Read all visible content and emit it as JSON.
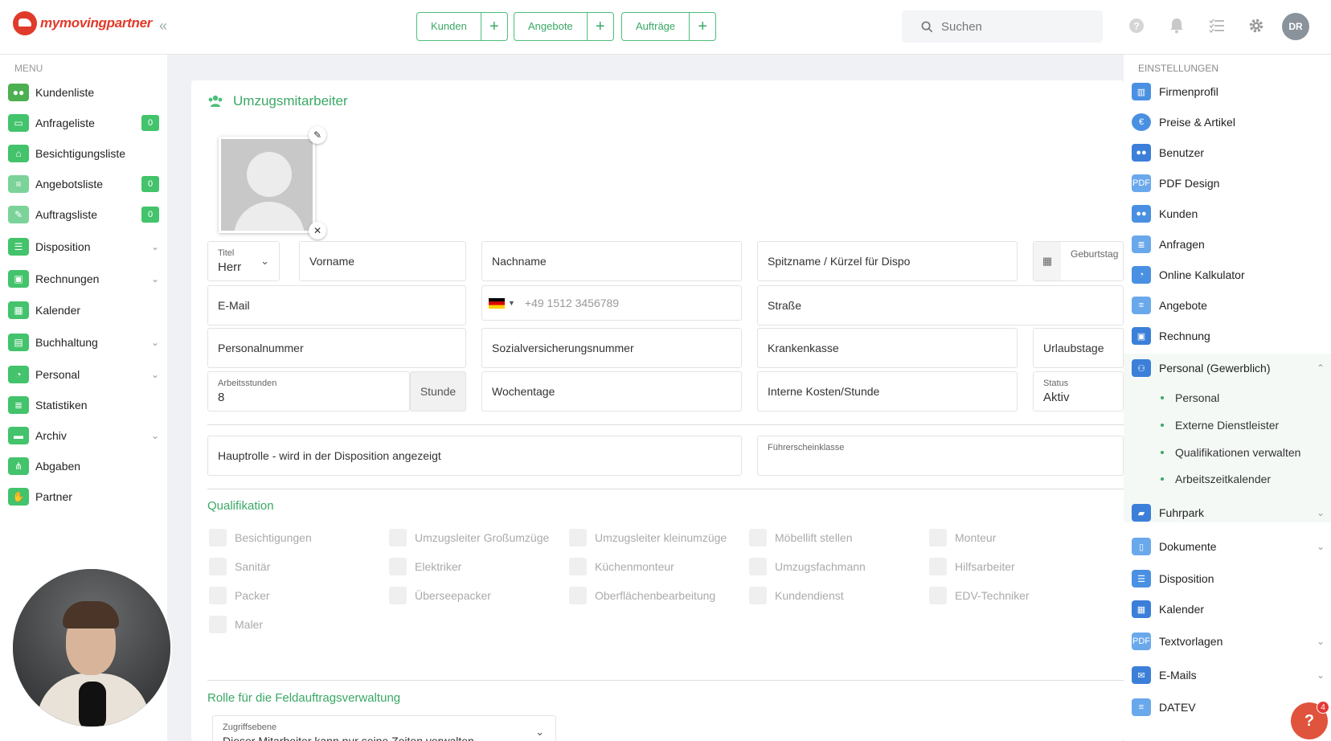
{
  "app": {
    "logo_text": "mymovingpartner"
  },
  "top": {
    "groups": [
      {
        "label": "Kunden"
      },
      {
        "label": "Angebote"
      },
      {
        "label": "Aufträge"
      }
    ],
    "search_placeholder": "Suchen",
    "avatar_initials": "DR"
  },
  "sidebar": {
    "title": "MENU",
    "items": [
      {
        "label": "Kundenliste",
        "color": "#4caf50"
      },
      {
        "label": "Anfrageliste",
        "badge": "0",
        "color": "#43c36b"
      },
      {
        "label": "Besichtigungsliste",
        "color": "#43c36b"
      },
      {
        "label": "Angebotsliste",
        "badge": "0",
        "color": "#7bd39a"
      },
      {
        "label": "Auftragsliste",
        "badge": "0",
        "color": "#7bd39a"
      },
      {
        "label": "Disposition",
        "color": "#43c36b"
      },
      {
        "label": "Rechnungen",
        "color": "#43c36b"
      },
      {
        "label": "Kalender",
        "color": "#43c36b"
      },
      {
        "label": "Buchhaltung",
        "color": "#43c36b"
      },
      {
        "label": "Personal",
        "color": "#43c36b"
      },
      {
        "label": "Statistiken",
        "color": "#43c36b"
      },
      {
        "label": "Archiv",
        "color": "#43c36b"
      },
      {
        "label": "Abgaben",
        "color": "#43c36b"
      },
      {
        "label": "Partner",
        "color": "#43c36b"
      }
    ]
  },
  "form": {
    "title": "Umzugsmitarbeiter",
    "titel_label": "Titel",
    "titel_value": "Herr",
    "vorname": "Vorname",
    "nachname": "Nachname",
    "spitzname": "Spitzname / Kürzel für Dispo",
    "geburtstag": "Geburtstag",
    "email": "E-Mail",
    "phone_placeholder": "+49 1512 3456789",
    "strasse": "Straße",
    "personalnummer": "Personalnummer",
    "sozialversicherungsnummer": "Sozialversicherungsnummer",
    "krankenkasse": "Krankenkasse",
    "urlaubstage": "Urlaubstage",
    "arbeitsstunden_label": "Arbeitsstunden",
    "arbeitsstunden_value": "8",
    "stunde": "Stunde",
    "wochentage": "Wochentage",
    "interne_kosten": "Interne Kosten/Stunde",
    "status_label": "Status",
    "status_value": "Aktiv",
    "hauptrolle": "Hauptrolle - wird in der Disposition angezeigt",
    "fuehrerscheinklasse": "Führerscheinklasse",
    "qualifikation_title": "Qualifikation",
    "qualifikationen": [
      "Besichtigungen",
      "Umzugsleiter Großumzüge",
      "Umzugsleiter kleinumzüge",
      "Möbellift stellen",
      "Monteur",
      "Sanitär",
      "Elektriker",
      "Küchenmonteur",
      "Umzugsfachmann",
      "Hilfsarbeiter",
      "Packer",
      "Überseepacker",
      "Oberflächenbearbeitung",
      "Kundendienst",
      "EDV-Techniker",
      "Maler"
    ],
    "rolle_title": "Rolle für die Feldauftragsverwaltung",
    "zugriffsebene_label": "Zugriffsebene",
    "zugriffsebene_value": "Dieser Mitarbeiter kann nur seine Zeiten verwalten"
  },
  "settings": {
    "title": "EINSTELLUNGEN",
    "items": [
      {
        "label": "Firmenprofil",
        "color": "#4a90e2"
      },
      {
        "label": "Preise & Artikel",
        "color": "#4a90e2"
      },
      {
        "label": "Benutzer",
        "color": "#3b7fd9"
      },
      {
        "label": "PDF Design",
        "color": "#6aa8ec"
      },
      {
        "label": "Kunden",
        "color": "#4a90e2"
      },
      {
        "label": "Anfragen",
        "color": "#6aa8ec"
      },
      {
        "label": "Online Kalkulator",
        "color": "#4a90e2"
      },
      {
        "label": "Angebote",
        "color": "#6aa8ec"
      },
      {
        "label": "Rechnung",
        "color": "#3b7fd9"
      },
      {
        "label": "Personal (Gewerblich)",
        "color": "#3b7fd9"
      }
    ],
    "subitems": [
      "Personal",
      "Externe Dienstleister",
      "Qualifikationen verwalten",
      "Arbeitszeitkalender"
    ],
    "items2": [
      {
        "label": "Fuhrpark",
        "color": "#3b7fd9",
        "chev": true
      },
      {
        "label": "Dokumente",
        "color": "#6aa8ec",
        "chev": true
      },
      {
        "label": "Disposition",
        "color": "#4a90e2",
        "chev": false
      },
      {
        "label": "Kalender",
        "color": "#3b7fd9",
        "chev": false
      },
      {
        "label": "Textvorlagen",
        "color": "#6aa8ec",
        "chev": true
      },
      {
        "label": "E-Mails",
        "color": "#3b7fd9",
        "chev": true
      },
      {
        "label": "DATEV",
        "color": "#6aa8ec",
        "chev": false
      }
    ]
  },
  "help": {
    "badge": "4"
  }
}
